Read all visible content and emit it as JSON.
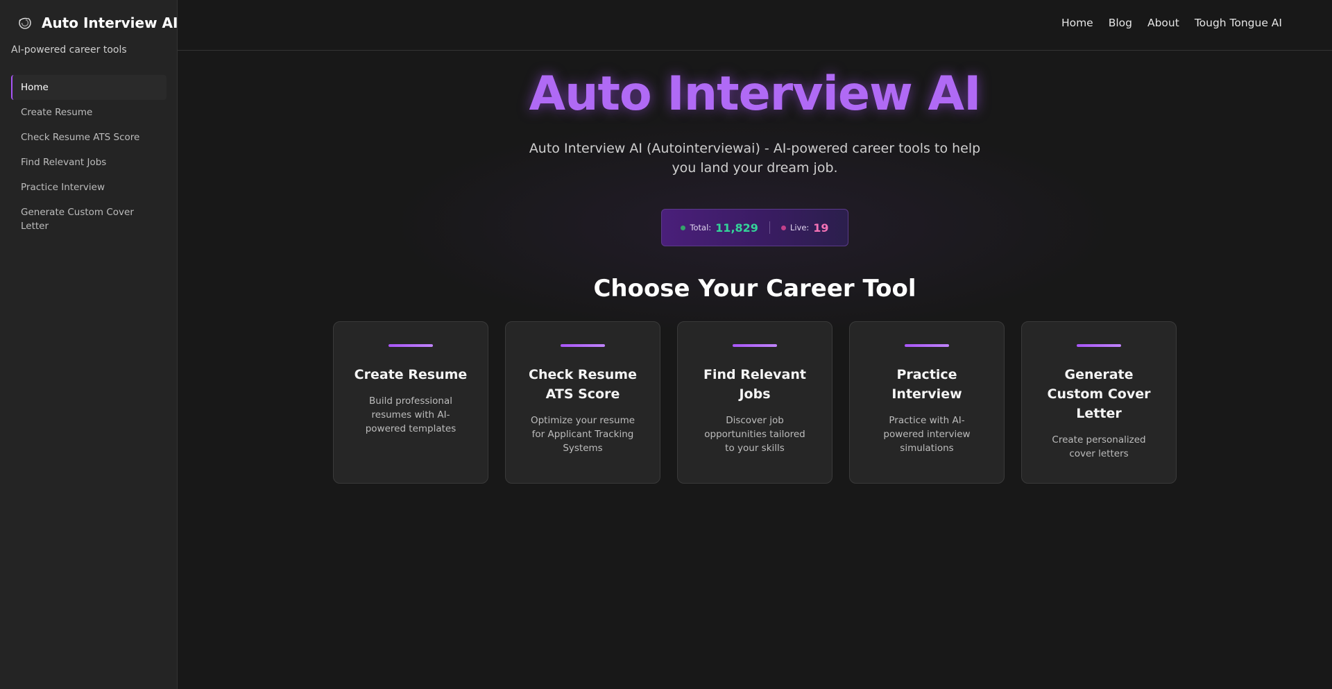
{
  "app": {
    "title": "Auto Interview AI",
    "tagline": "AI-powered career tools",
    "accent": "#a855f7",
    "background": "#181818",
    "sidebar_background": "#242424"
  },
  "sidebar": {
    "items": [
      {
        "label": "Home",
        "active": true
      },
      {
        "label": "Create Resume",
        "active": false
      },
      {
        "label": "Check Resume ATS Score",
        "active": false
      },
      {
        "label": "Find Relevant Jobs",
        "active": false
      },
      {
        "label": "Practice Interview",
        "active": false
      },
      {
        "label": "Generate Custom Cover Letter",
        "active": false
      }
    ]
  },
  "topnav": {
    "links": [
      "Home",
      "Blog",
      "About",
      "Tough Tongue AI"
    ]
  },
  "hero": {
    "title": "Auto Interview AI",
    "subtitle": "Auto Interview AI (Autointerviewai) - AI-powered career tools to help you land your dream job."
  },
  "stats": {
    "total_label": "Total:",
    "total_value": "11,829",
    "live_label": "Live:",
    "live_value": "19",
    "total_color": "#34d399",
    "live_color": "#f472b6"
  },
  "tools": {
    "heading": "Choose Your Career Tool",
    "cards": [
      {
        "title": "Create Resume",
        "description": "Build professional resumes with AI-powered templates"
      },
      {
        "title": "Check Resume ATS Score",
        "description": "Optimize your resume for Applicant Tracking Systems"
      },
      {
        "title": "Find Relevant Jobs",
        "description": "Discover job opportunities tailored to your skills"
      },
      {
        "title": "Practice Interview",
        "description": "Practice with AI-powered interview simulations"
      },
      {
        "title": "Generate Custom Cover Letter",
        "description": "Create personalized cover letters"
      }
    ]
  },
  "icons": {
    "brand": "swirl-logo-icon"
  }
}
